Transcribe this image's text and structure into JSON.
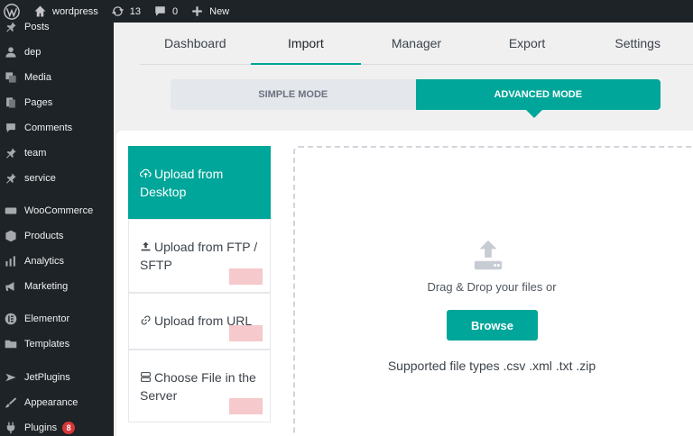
{
  "adminbar": {
    "site_name": "wordpress",
    "updates_count": "13",
    "comments_count": "0",
    "new_label": "New"
  },
  "sidebar": {
    "items": [
      {
        "label": "Posts",
        "icon": "pin-icon"
      },
      {
        "label": "dep",
        "icon": "user-icon"
      },
      {
        "label": "Media",
        "icon": "media-icon"
      },
      {
        "label": "Pages",
        "icon": "pages-icon"
      },
      {
        "label": "Comments",
        "icon": "comment-icon"
      },
      {
        "label": "team",
        "icon": "pin-icon"
      },
      {
        "label": "service",
        "icon": "pin-icon"
      },
      {
        "label": "WooCommerce",
        "icon": "woo-icon"
      },
      {
        "label": "Products",
        "icon": "box-icon"
      },
      {
        "label": "Analytics",
        "icon": "chart-icon"
      },
      {
        "label": "Marketing",
        "icon": "megaphone-icon"
      },
      {
        "label": "Elementor",
        "icon": "elementor-icon"
      },
      {
        "label": "Templates",
        "icon": "folder-icon"
      },
      {
        "label": "JetPlugins",
        "icon": "jet-icon"
      },
      {
        "label": "Appearance",
        "icon": "brush-icon"
      },
      {
        "label": "Plugins",
        "icon": "plug-icon",
        "badge": "8"
      }
    ]
  },
  "tabs": [
    "Dashboard",
    "Import",
    "Manager",
    "Export",
    "Settings"
  ],
  "active_tab": "Import",
  "modes": {
    "simple": "SIMPLE MODE",
    "advanced": "ADVANCED MODE"
  },
  "upload_options": [
    {
      "label": "Upload from Desktop",
      "icon": "cloud-upload-icon"
    },
    {
      "label": "Upload from FTP / SFTP",
      "icon": "upload-icon"
    },
    {
      "label": "Upload from URL",
      "icon": "link-icon"
    },
    {
      "label": "Choose File in the Server",
      "icon": "server-icon"
    }
  ],
  "dropzone": {
    "icon": "upload-tray-icon",
    "text": "Drag & Drop your files or",
    "button": "Browse",
    "supported": "Supported file types .csv .xml .txt .zip"
  },
  "colors": {
    "accent": "#00a699",
    "admin_dark": "#1d2327",
    "badge": "#d63638"
  }
}
